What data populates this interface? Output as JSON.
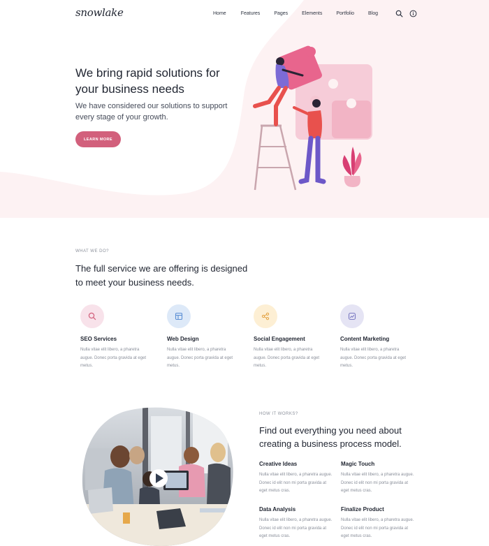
{
  "brand": {
    "logo": "snowlake",
    "accent": "#d2607c",
    "hero_bg": "#fdf2f3"
  },
  "nav": {
    "links": [
      "Home",
      "Features",
      "Pages",
      "Elements",
      "Portfolio",
      "Blog"
    ],
    "icons": [
      "search-icon",
      "info-icon"
    ]
  },
  "hero": {
    "title": "We bring rapid solutions for your business needs",
    "subtitle": "We have considered our solutions to support every stage of your growth.",
    "cta": "LEARN MORE",
    "illustration": "puzzle-team-illustration"
  },
  "services": {
    "eyebrow": "WHAT WE DO?",
    "title": "The full service we are offering is designed to meet your business needs.",
    "items": [
      {
        "name": "SEO Services",
        "icon": "search-icon",
        "color": "#f8e2ea",
        "icon_color": "#d2607c",
        "text": "Nulla vitae elit libero, a pharetra augue. Donec porta gravida at eget metus."
      },
      {
        "name": "Web Design",
        "icon": "layout-icon",
        "color": "#dde9f8",
        "icon_color": "#5b8fd4",
        "text": "Nulla vitae elit libero, a pharetra augue. Donec porta gravida at eget metus."
      },
      {
        "name": "Social Engagement",
        "icon": "share-icon",
        "color": "#fdefd4",
        "icon_color": "#e3a243",
        "text": "Nulla vitae elit libero, a pharetra augue. Donec porta gravida at eget metus."
      },
      {
        "name": "Content Marketing",
        "icon": "chart-icon",
        "color": "#e5e4f4",
        "icon_color": "#7b7ac2",
        "text": "Nulla vitae elit libero, a pharetra augue. Donec porta gravida at eget metus."
      }
    ]
  },
  "how": {
    "eyebrow": "HOW IT WORKS?",
    "title": "Find out everything you need about creating a business process model.",
    "steps": [
      {
        "name": "Creative Ideas",
        "text": "Nulla vitae elit libero, a pharetra augue. Donec id elit non mi porta gravida at eget metus cras."
      },
      {
        "name": "Magic Touch",
        "text": "Nulla vitae elit libero, a pharetra augue. Donec id elit non mi porta gravida at eget metus cras."
      },
      {
        "name": "Data Analysis",
        "text": "Nulla vitae elit libero, a pharetra augue. Donec id elit non mi porta gravida at eget metus cras."
      },
      {
        "name": "Finalize Product",
        "text": "Nulla vitae elit libero, a pharetra augue. Donec id elit non mi porta gravida at eget metus cras."
      }
    ],
    "media": {
      "icon": "play-icon"
    }
  }
}
